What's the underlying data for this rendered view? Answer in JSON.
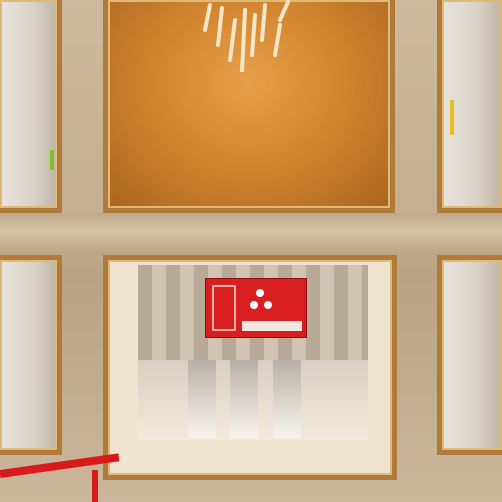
{
  "scene": {
    "colors": {
      "wall": "#c8b398",
      "frame": "#b07a3a",
      "glow": "#d3862f",
      "accent_red": "#d81e1e"
    },
    "objects": [
      "chandelier",
      "glowing-ceiling-panel",
      "bowling-lanes",
      "red-scoreboard",
      "red-railing"
    ]
  }
}
